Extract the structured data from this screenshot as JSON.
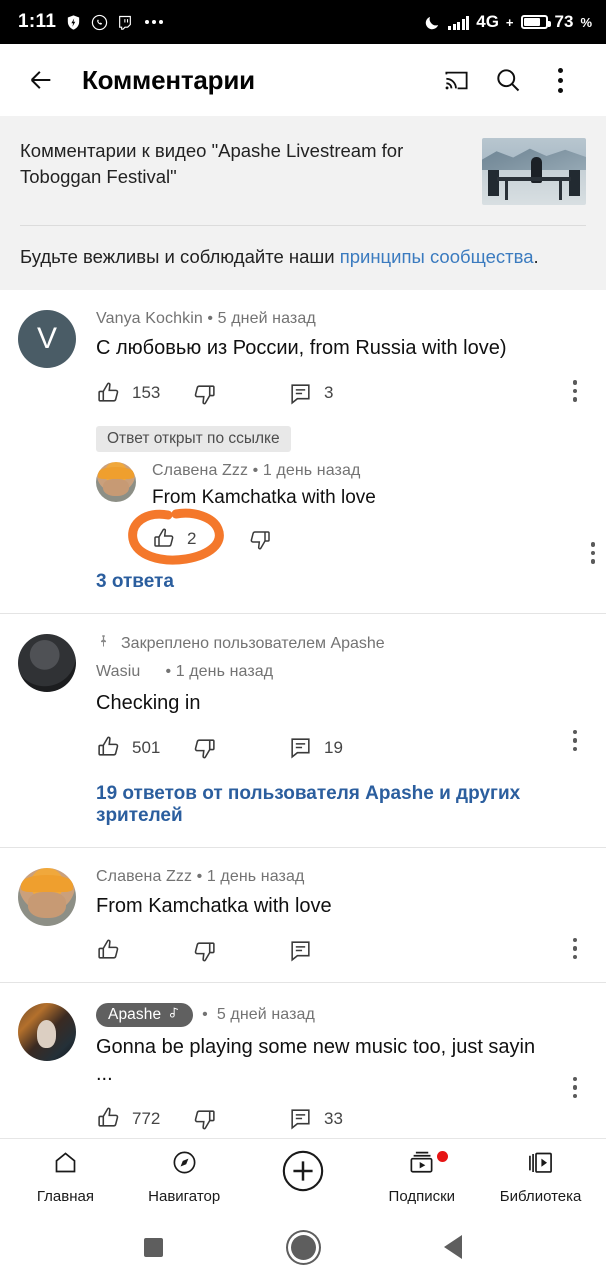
{
  "statusbar": {
    "time": "1:11",
    "icons": [
      "shield-icon",
      "whatsapp-icon",
      "twitch-icon",
      "more-dots-icon"
    ],
    "network": "4G",
    "network_plus": "+",
    "battery_percent": "73",
    "percent_symbol": "%"
  },
  "header": {
    "back_label": "back-arrow",
    "title": "Комментарии",
    "cast_label": "cast-icon",
    "search_label": "search-icon",
    "menu_label": "overflow-menu"
  },
  "video_info": {
    "text": "Комментарии к видео \"Apashe Livestream for Toboggan Festival\"",
    "thumbnail_alt": "video-thumbnail"
  },
  "guidelines": {
    "prefix": "Будьте вежливы и соблюдайте наши ",
    "link": "принципы сообщества",
    "suffix": "."
  },
  "comments": [
    {
      "id": "comment-vanya",
      "avatar_letter": "V",
      "author": "Vanya Kochkin",
      "separator": "•",
      "time": "5 дней назад",
      "text": "С любовью из России,  from Russia with love)",
      "likes": "153",
      "replies_count": "3",
      "reply_badge": "Ответ открыт по ссылке",
      "reply": {
        "id": "reply-slavena",
        "author": "Славена Zzz",
        "separator": "•",
        "time": "1 день назад",
        "text": "From Kamchatka with love",
        "likes": "2",
        "annotated": true
      },
      "replies_link": "3 ответа"
    },
    {
      "id": "comment-wasiu",
      "pinned_text": "Закреплено пользователем Apashe",
      "author": "Wasiu",
      "separator": "•",
      "time": "1 день назад",
      "text": "Checking in",
      "likes": "501",
      "replies_count": "19",
      "replies_link": "19 ответов от пользователя Apashe и других зрителей"
    },
    {
      "id": "comment-slavena",
      "author": "Славена Zzz",
      "separator": "•",
      "time": "1 день назад",
      "text": "From Kamchatka with love",
      "likes": "",
      "replies_count": ""
    },
    {
      "id": "comment-apashe",
      "author_badge": "Apashe",
      "separator": "•",
      "time": "5 дней назад",
      "text": "Gonna be playing some new music too, just sayin ...",
      "likes": "772",
      "replies_count": "33"
    }
  ],
  "bottom_nav": [
    {
      "icon": "home-icon",
      "label": "Главная"
    },
    {
      "icon": "compass-icon",
      "label": "Навигатор"
    },
    {
      "icon": "plus-circle-icon",
      "label": ""
    },
    {
      "icon": "subscriptions-icon",
      "label": "Подписки",
      "badge": true
    },
    {
      "icon": "library-icon",
      "label": "Библиотека"
    }
  ],
  "system_nav": [
    "recents-square",
    "home-circle",
    "back-triangle"
  ],
  "colors": {
    "link_blue": "#2b5e9e",
    "guideline_link": "#3b7bbf",
    "annotation_orange": "#f4782b",
    "badge_red": "#e61414",
    "panel_gray": "#f2f2f2"
  }
}
